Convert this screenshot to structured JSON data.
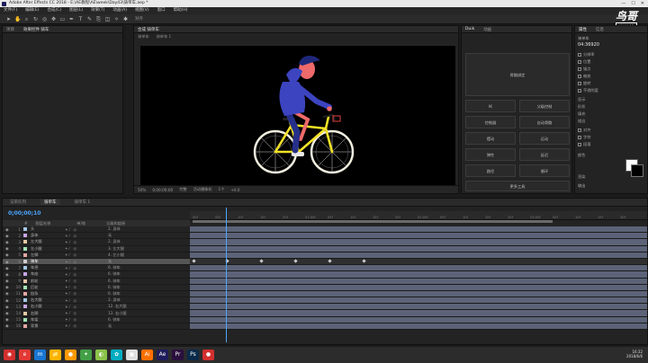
{
  "window": {
    "title": "Adobe After Effects CC 2018 - E:\\AE教程\\AE\\week\\Day43\\骑单车.aep *",
    "controls": [
      "—",
      "☐",
      "✕"
    ]
  },
  "menu": [
    "文件(F)",
    "编辑(E)",
    "合成(C)",
    "图层(L)",
    "效果(T)",
    "动画(A)",
    "视图(V)",
    "窗口",
    "帮助(H)"
  ],
  "toolbar": {
    "snap_label": "对齐"
  },
  "watermark": {
    "line1": "鸟哥",
    "line2": "原画坊"
  },
  "project_panel": {
    "tabs": [
      "项目",
      "效果控件 骑车"
    ]
  },
  "comp_panel": {
    "tabs": [
      "合成 骑单车"
    ],
    "sub": [
      "骑单车",
      "骑单车 1"
    ],
    "footer": [
      "50%",
      "0;00;00;00",
      "完整",
      "活动摄像机",
      "1个",
      "+0.0"
    ]
  },
  "script_panel": {
    "tabs": [
      "Duik",
      "动画"
    ],
    "buttons": [
      "骨骼绑定",
      "IK",
      "父级控制",
      "控制器",
      "自动骨骼",
      "摆动",
      "运动",
      "弹性",
      "延迟",
      "路径",
      "循环",
      "更多工具"
    ]
  },
  "props_panel": {
    "tabs": [
      "属性",
      "信息"
    ],
    "rows": [
      "骑单车",
      "04:36920",
      "分辨率",
      "位置",
      "锚点",
      "缩放",
      "旋转",
      "不透明度",
      "显示",
      "形状",
      "填充",
      "描边",
      "对齐",
      "字符",
      "段落",
      "颜色",
      "渲染",
      "输出"
    ]
  },
  "timeline": {
    "tabs": [
      "渲染队列",
      "骑单车",
      "骑单车 1"
    ],
    "timecode": "0;00;00;10",
    "header": [
      "#",
      "图层名称",
      "单/效",
      "父级和链接"
    ],
    "ticks": [
      "00f",
      "05f",
      "10f",
      "15f",
      "20f",
      "01:00f",
      "05f",
      "10f",
      "15f",
      "20f",
      "02:00f",
      "05f",
      "10f",
      "15f",
      "20f",
      "03:00f",
      "05f",
      "10f",
      "15f",
      "20f"
    ],
    "layers": [
      {
        "num": "1",
        "name": "头",
        "parent": "2. 身体",
        "color": "#a4c6e6"
      },
      {
        "num": "2",
        "name": "身体",
        "parent": "无",
        "color": "#c7a6e8"
      },
      {
        "num": "3",
        "name": "左大腿",
        "parent": "2. 身体",
        "color": "#e6c7a4"
      },
      {
        "num": "4",
        "name": "左小腿",
        "parent": "3. 左大腿",
        "color": "#a4e6b5"
      },
      {
        "num": "5",
        "name": "左脚",
        "parent": "4. 左小腿",
        "color": "#e6a4a4"
      },
      {
        "num": "6",
        "name": "骑车",
        "parent": "无",
        "color": "#cccccc"
      },
      {
        "num": "7",
        "name": "车把",
        "parent": "6. 骑车",
        "color": "#a4c6e6"
      },
      {
        "num": "8",
        "name": "车座",
        "parent": "6. 骑车",
        "color": "#c7a6e8"
      },
      {
        "num": "9",
        "name": "前轮",
        "parent": "6. 骑车",
        "color": "#e6c7a4"
      },
      {
        "num": "10",
        "name": "后轮",
        "parent": "6. 骑车",
        "color": "#a4e6b5"
      },
      {
        "num": "11",
        "name": "链条",
        "parent": "6. 骑车",
        "color": "#e6a4a4"
      },
      {
        "num": "12",
        "name": "右大腿",
        "parent": "2. 身体",
        "color": "#a4c6e6"
      },
      {
        "num": "13",
        "name": "右小腿",
        "parent": "12. 右大腿",
        "color": "#c7a6e8"
      },
      {
        "num": "14",
        "name": "右脚",
        "parent": "13. 右小腿",
        "color": "#e6c7a4"
      },
      {
        "num": "15",
        "name": "车架",
        "parent": "6. 骑车",
        "color": "#a4e6b5"
      },
      {
        "num": "16",
        "name": "背景",
        "parent": "无",
        "color": "#e6a4a4"
      }
    ]
  },
  "taskbar": {
    "apps": [
      "◉",
      "e",
      "m",
      "📁",
      "●",
      "✦",
      "◐",
      "✿",
      "▣",
      "Ai",
      "Ae",
      "Pr",
      "Ps",
      "●"
    ],
    "app_colors": [
      "#d32f2f",
      "#e53935",
      "#1976d2",
      "#ffb300",
      "#ff9800",
      "#43a047",
      "#8bc34a",
      "#00acc1",
      "#e0e0e0",
      "#ff6f00",
      "#1f1c5c",
      "#2a0f3e",
      "#0a2a4a",
      "#d32f2f"
    ],
    "clock": [
      "16:32",
      "2018/6/6"
    ]
  }
}
